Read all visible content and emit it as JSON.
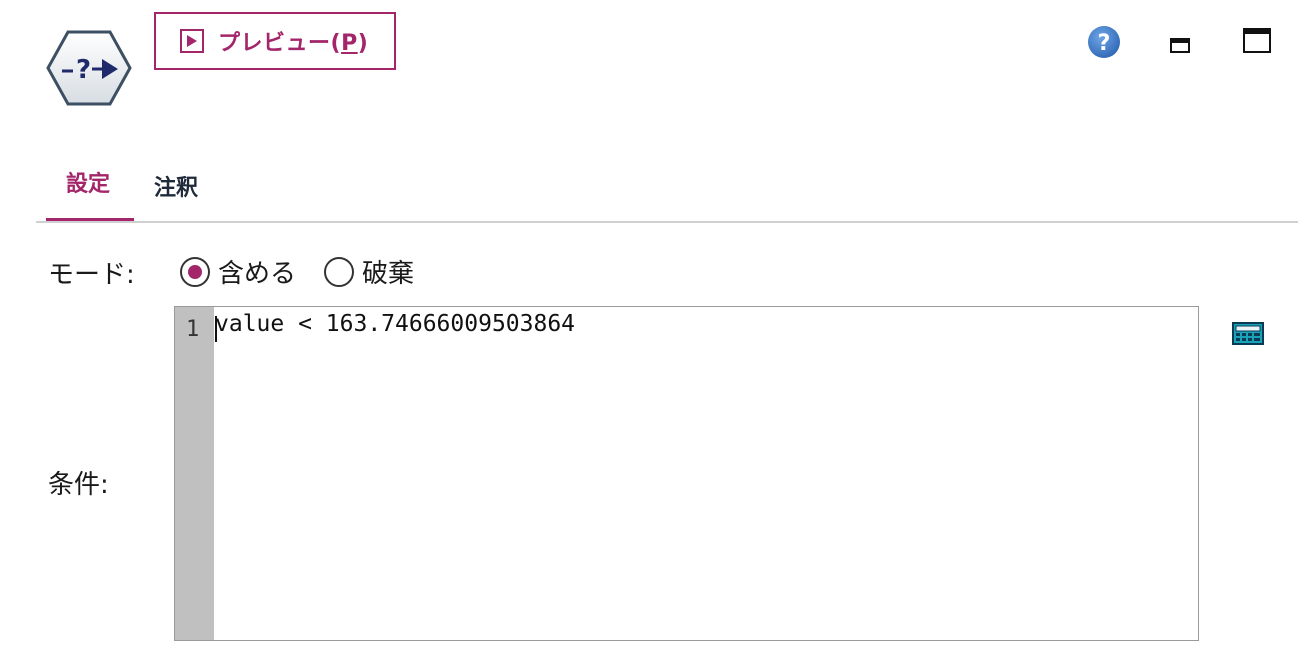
{
  "header": {
    "node_icon": "select-node-icon",
    "preview_label": "プレビュー(",
    "preview_mnemonic": "P",
    "preview_label_end": ")",
    "preview_icon": "play-icon",
    "help_icon": "help-icon",
    "minimize_icon": "minimize-icon",
    "maximize_icon": "maximize-icon"
  },
  "tabs": [
    {
      "label": "設定",
      "active": true
    },
    {
      "label": "注釈",
      "active": false
    }
  ],
  "mode": {
    "label": "モード:",
    "options": [
      {
        "label": "含める",
        "selected": true
      },
      {
        "label": "破棄",
        "selected": false
      }
    ]
  },
  "condition": {
    "label": "条件:",
    "line_number": "1",
    "code": "value < 163.74666009503864",
    "expression_builder_icon": "calculator-icon"
  },
  "colors": {
    "accent": "#a3266a",
    "help_blue": "#3a78c8",
    "gutter": "#c0c0c0",
    "text": "#1a1a1a"
  }
}
